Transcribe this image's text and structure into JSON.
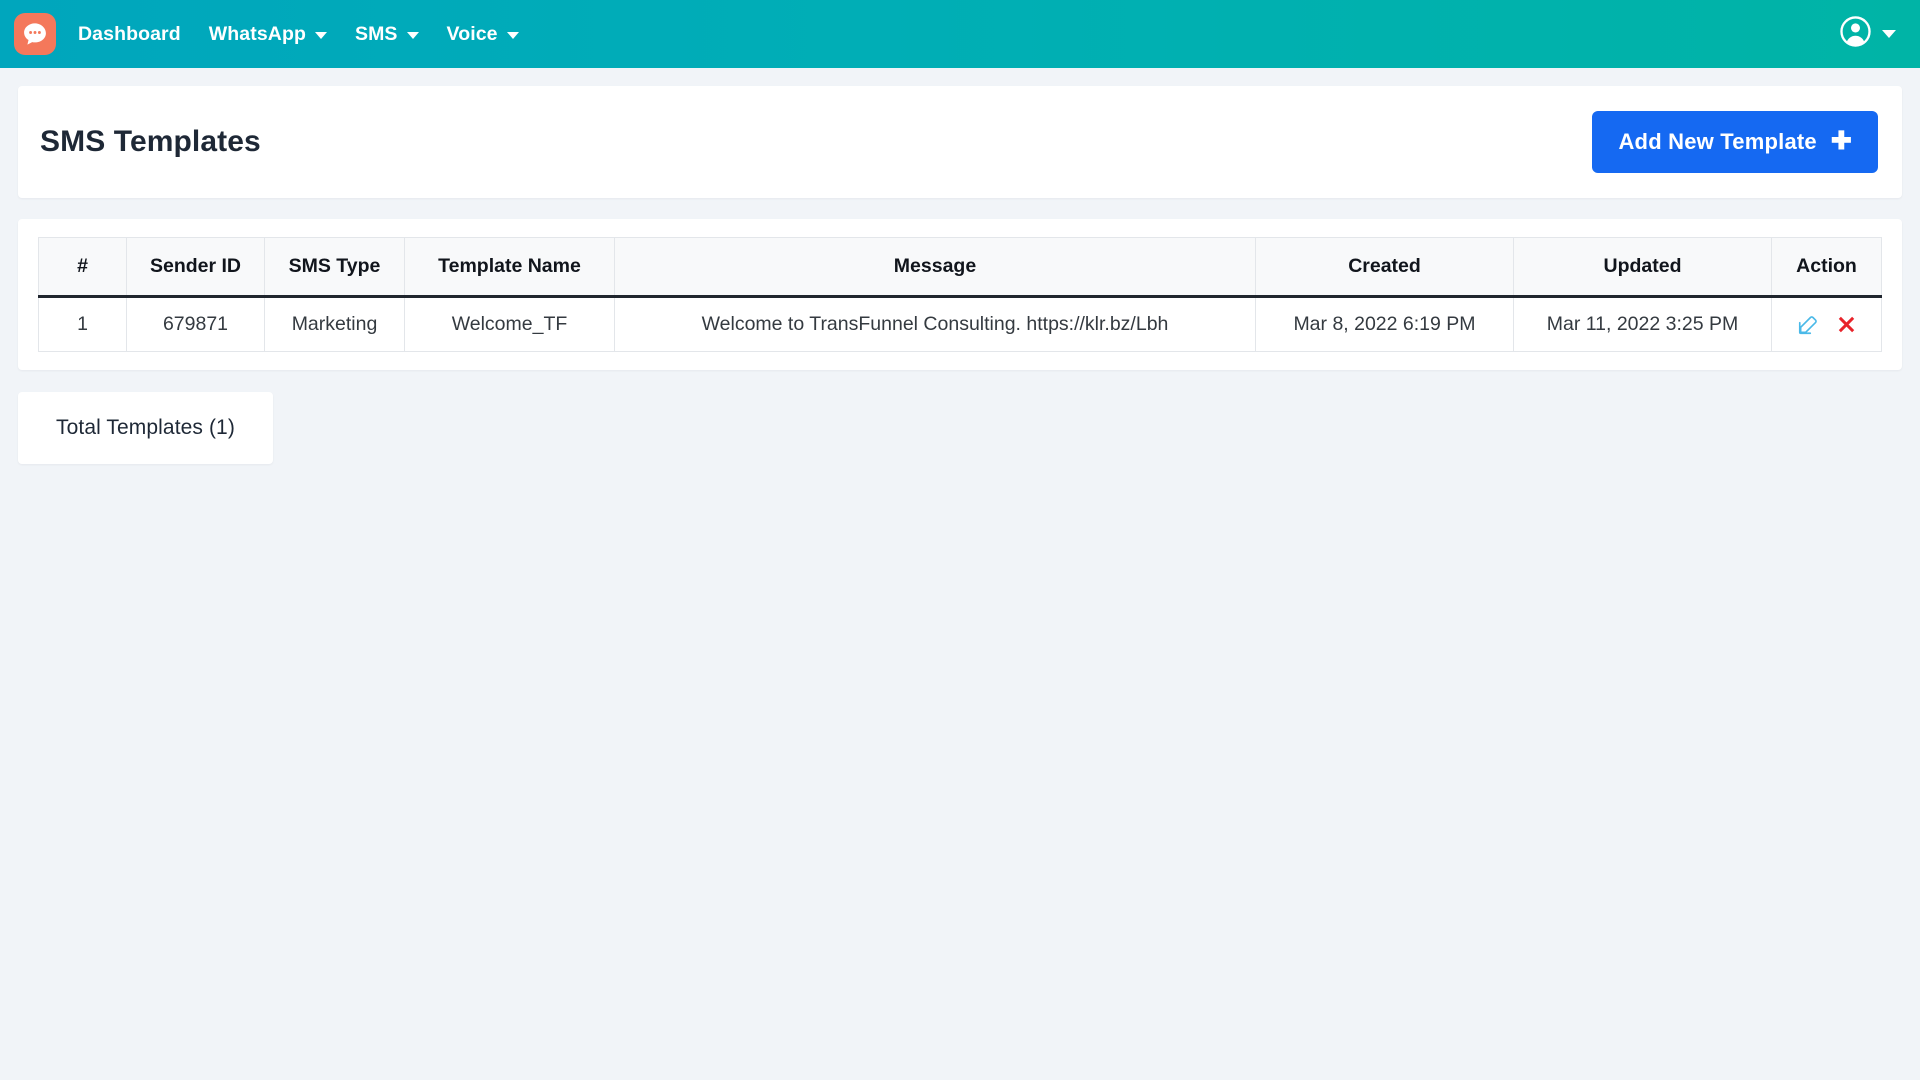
{
  "navbar": {
    "logo_icon": "chat-bubble-icon",
    "brand_color": "#f4785b",
    "bar_gradient_from": "#00a6bd",
    "bar_gradient_to": "#00b4a6",
    "links": [
      {
        "label": "Dashboard",
        "has_dropdown": false
      },
      {
        "label": "WhatsApp",
        "has_dropdown": true
      },
      {
        "label": "SMS",
        "has_dropdown": true
      },
      {
        "label": "Voice",
        "has_dropdown": true
      }
    ],
    "account": {
      "icon": "user-circle-icon",
      "has_dropdown": true
    }
  },
  "header": {
    "title": "SMS Templates",
    "add_button": {
      "label": "Add New Template",
      "icon": "plus-icon",
      "color": "#1569f2"
    }
  },
  "table": {
    "columns": [
      "#",
      "Sender ID",
      "SMS Type",
      "Template Name",
      "Message",
      "Created",
      "Updated",
      "Action"
    ],
    "rows": [
      {
        "num": "1",
        "sender_id": "679871",
        "sms_type": "Marketing",
        "template_name": "Welcome_TF",
        "message": "Welcome to TransFunnel Consulting. https://klr.bz/Lbh",
        "created": "Mar 8, 2022 6:19 PM",
        "updated": "Mar 11, 2022 3:25 PM",
        "actions": {
          "edit_icon": "edit-pencil-square-icon",
          "edit_color": "#4ab9e8",
          "delete_icon": "delete-cross-icon",
          "delete_color": "#e8232a"
        }
      }
    ]
  },
  "footer": {
    "total_label": "Total Templates (1)"
  }
}
